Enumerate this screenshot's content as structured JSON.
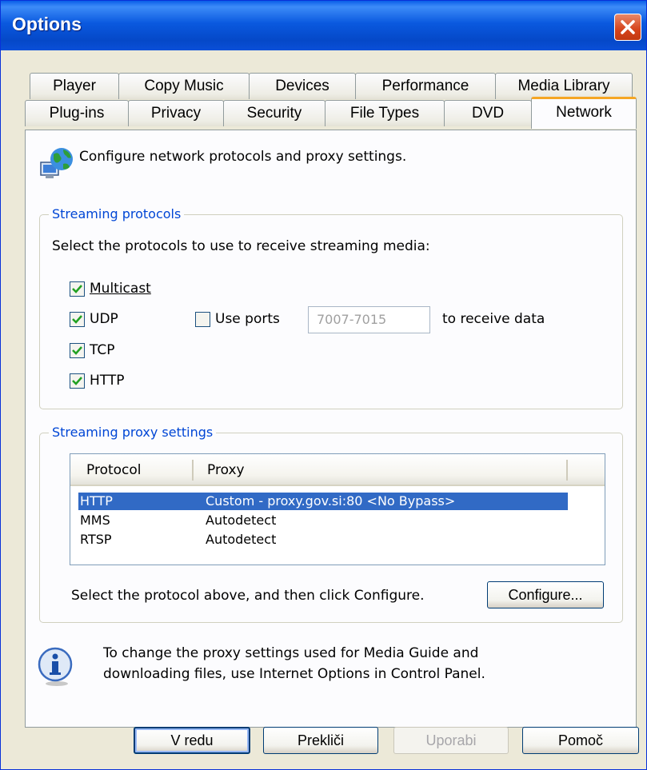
{
  "window": {
    "title": "Options"
  },
  "tabs_row1": [
    "Player",
    "Copy Music",
    "Devices",
    "Performance",
    "Media Library"
  ],
  "tabs_row2": [
    "Plug-ins",
    "Privacy",
    "Security",
    "File Types",
    "DVD",
    "Network"
  ],
  "active_tab": "Network",
  "heading": "Configure network protocols and proxy settings.",
  "streaming_protocols": {
    "legend": "Streaming protocols",
    "instruction": "Select the protocols to use to receive streaming media:",
    "multicast": {
      "label": "Multicast",
      "checked": true
    },
    "udp": {
      "label": "UDP",
      "checked": true
    },
    "tcp": {
      "label": "TCP",
      "checked": true
    },
    "http": {
      "label": "HTTP",
      "checked": true
    },
    "use_ports": {
      "label": "Use ports",
      "checked": false
    },
    "ports_value": "7007-7015",
    "ports_suffix": "to receive data"
  },
  "proxy_settings": {
    "legend": "Streaming proxy settings",
    "columns": [
      "Protocol",
      "Proxy"
    ],
    "rows": [
      {
        "protocol": "HTTP",
        "proxy": "Custom - proxy.gov.si:80 <No Bypass>",
        "selected": true
      },
      {
        "protocol": "MMS",
        "proxy": "Autodetect",
        "selected": false
      },
      {
        "protocol": "RTSP",
        "proxy": "Autodetect",
        "selected": false
      }
    ],
    "hint": "Select the protocol above, and then click Configure.",
    "configure_label": "Configure..."
  },
  "info": {
    "line1": "To change the proxy settings used for Media Guide and",
    "line2": "downloading files, use Internet Options in Control Panel."
  },
  "footer": {
    "ok_label": "V redu",
    "cancel_label": "Prekliči",
    "apply_label": "Uporabi",
    "help_label": "Pomoč"
  },
  "colors": {
    "titlebar": "#0a59df",
    "selection": "#316ac5",
    "legend_text": "#0046d5",
    "active_tab_accent": "#f5a623"
  }
}
